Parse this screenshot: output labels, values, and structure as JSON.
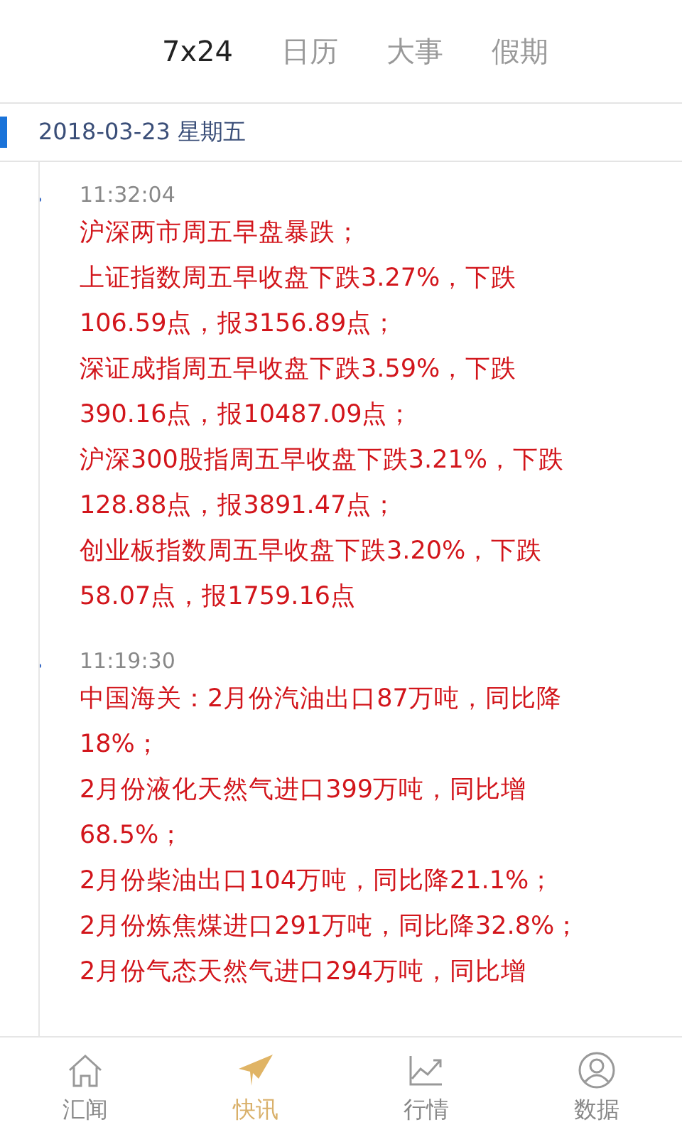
{
  "tabs": [
    {
      "label": "7x24",
      "selected": true
    },
    {
      "label": "日历",
      "selected": false
    },
    {
      "label": "大事",
      "selected": false
    },
    {
      "label": "假期",
      "selected": false
    }
  ],
  "date": "2018-03-23 星期五",
  "news": [
    {
      "time": "11:32:04",
      "lines": [
        "沪深两市周五早盘暴跌；",
        "上证指数周五早收盘下跌3.27%，下跌",
        "106.59点，报3156.89点；",
        "深证成指周五早收盘下跌3.59%，下跌",
        "390.16点，报10487.09点；",
        "沪深300股指周五早收盘下跌3.21%，下跌",
        "128.88点，报3891.47点；",
        "创业板指数周五早收盘下跌3.20%，下跌",
        "58.07点，报1759.16点"
      ]
    },
    {
      "time": "11:19:30",
      "lines": [
        "中国海关：2月份汽油出口87万吨，同比降",
        "18%；",
        "2月份液化天然气进口399万吨，同比增",
        "68.5%；",
        "2月份柴油出口104万吨，同比降21.1%；",
        "2月份炼焦煤进口291万吨，同比降32.8%；",
        "2月份气态天然气进口294万吨，同比增"
      ]
    }
  ],
  "nav": [
    {
      "label": "汇闻",
      "kind": "home",
      "selected": false
    },
    {
      "label": "快讯",
      "kind": "plane",
      "selected": true
    },
    {
      "label": "行情",
      "kind": "chart",
      "selected": false
    },
    {
      "label": "数据",
      "kind": "user",
      "selected": false
    }
  ]
}
